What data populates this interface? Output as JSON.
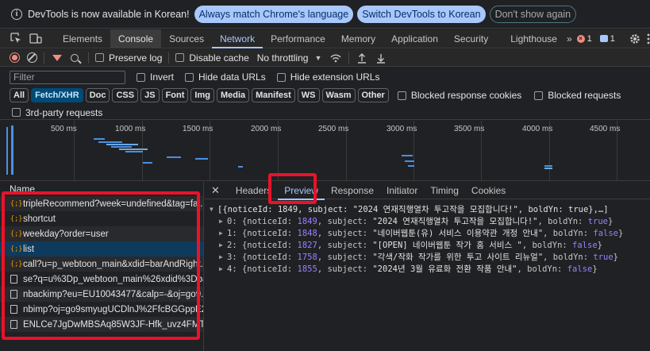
{
  "infobar": {
    "text": "DevTools is now available in Korean!",
    "btn_match": "Always match Chrome's language",
    "btn_switch": "Switch DevTools to Korean",
    "btn_dismiss": "Don't show again"
  },
  "tabs": [
    "Elements",
    "Console",
    "Sources",
    "Network",
    "Performance",
    "Memory",
    "Application",
    "Security",
    "Lighthouse"
  ],
  "counters": {
    "errors": "1",
    "messages": "1"
  },
  "toolbar": {
    "preserve_log": "Preserve log",
    "disable_cache": "Disable cache",
    "throttling": "No throttling"
  },
  "filter": {
    "placeholder": "Filter",
    "invert": "Invert",
    "hide_data_urls": "Hide data URLs",
    "hide_extension_urls": "Hide extension URLs"
  },
  "types": [
    "All",
    "Fetch/XHR",
    "Doc",
    "CSS",
    "JS",
    "Font",
    "Img",
    "Media",
    "Manifest",
    "WS",
    "Wasm",
    "Other"
  ],
  "types_extra": {
    "blocked_cookies": "Blocked response cookies",
    "blocked_requests": "Blocked requests",
    "third_party": "3rd-party requests"
  },
  "timeline": {
    "ticks": [
      "500 ms",
      "1000 ms",
      "1500 ms",
      "2000 ms",
      "2500 ms",
      "3000 ms",
      "3500 ms",
      "4000 ms",
      "4500 ms"
    ]
  },
  "requests": {
    "header": "Name",
    "items": [
      {
        "type": "xhr",
        "name": "tripleRecommend?week=undefined&tag=fal..."
      },
      {
        "type": "xhr",
        "name": "shortcut"
      },
      {
        "type": "xhr",
        "name": "weekday?order=user"
      },
      {
        "type": "xhr",
        "name": "list",
        "selected": true
      },
      {
        "type": "xhr",
        "name": "call?u=p_webtoon_main&xdid=barAndRight..."
      },
      {
        "type": "doc",
        "name": "se?q=u%3Dp_webtoon_main%26xdid%3Dba..."
      },
      {
        "type": "doc",
        "name": "nbackimp?eu=EU10043477&calp=-&oj=go9..."
      },
      {
        "type": "doc",
        "name": "nbimp?oj=go9smyugUCDlnJ%2FfcBGGppE2..."
      },
      {
        "type": "doc",
        "name": "ENLCe7JgDwMBSAq85W3JF-Hfk_uvz4FMTGl..."
      }
    ]
  },
  "detail": {
    "tabs": [
      "Headers",
      "Preview",
      "Response",
      "Initiator",
      "Timing",
      "Cookies"
    ],
    "summary": "[{noticeId: 1849, subject: \"2024 연재직행열차 투고작을 모집합니다!\", boldYn: true},…]",
    "rows": [
      {
        "index": "0",
        "id": "1849",
        "subject": "\"2024 연재직행열차 투고작을 모집합니다!\"",
        "bold": "true"
      },
      {
        "index": "1",
        "id": "1848",
        "subject": "\"네이버웹툰(유) 서비스 이용약관 개정 안내\"",
        "bold": "false"
      },
      {
        "index": "2",
        "id": "1827",
        "subject": "\"[OPEN] 네이버웹툰 작가 홈 서비스 \"",
        "bold": "false"
      },
      {
        "index": "3",
        "id": "1758",
        "subject": "\"각색/작화 작가를 위한 투고 사이트 리뉴얼\"",
        "bold": "true"
      },
      {
        "index": "4",
        "id": "1855",
        "subject": "\"2024년 3월 유료화 전환 작품 안내\"",
        "bold": "false"
      }
    ]
  }
}
